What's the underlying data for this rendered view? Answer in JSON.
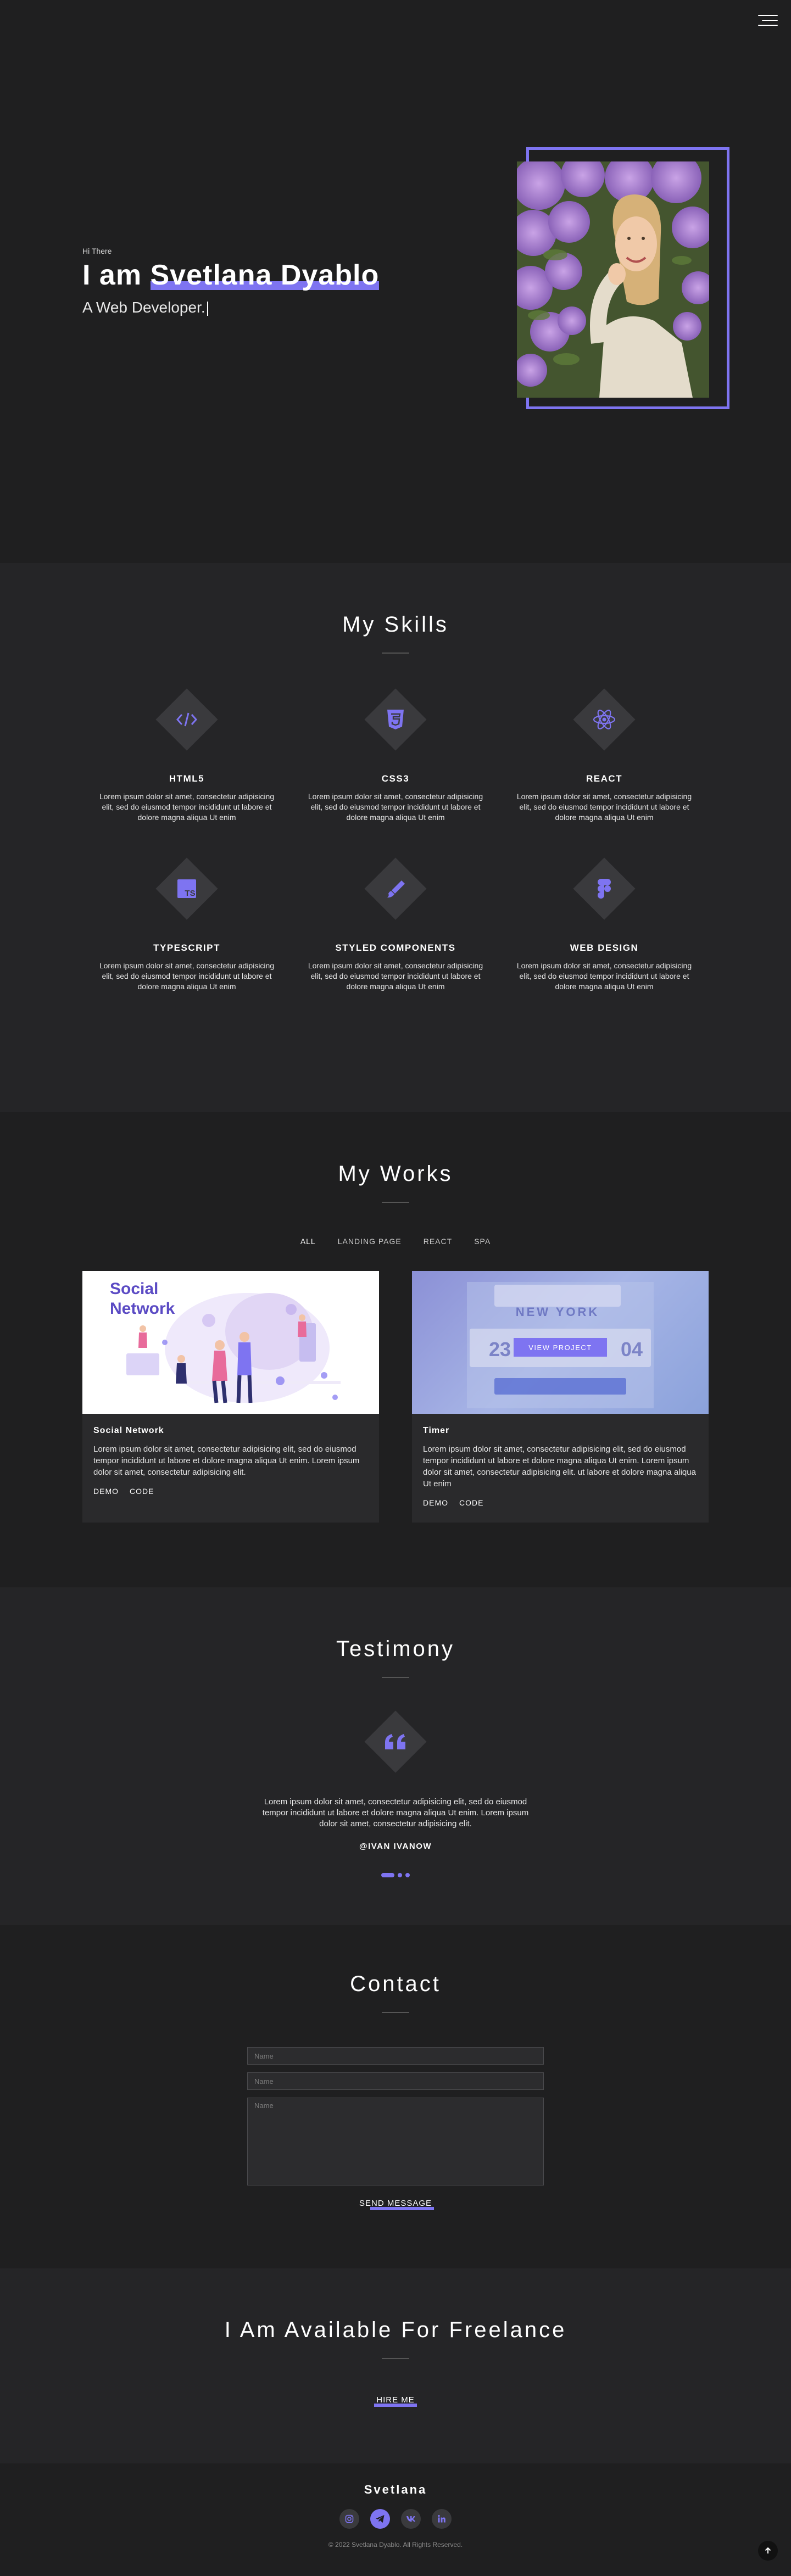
{
  "hero": {
    "greeting": "Hi There",
    "title_prefix": "I am ",
    "name": "Svetlana Dyablo",
    "subtitle": "A Web Developer."
  },
  "skills": {
    "title": "My Skills",
    "items": [
      {
        "name": "HTML5",
        "icon": "code-icon",
        "desc": "Lorem ipsum dolor sit amet, consectetur adipisicing elit, sed do eiusmod tempor incididunt ut labore et dolore magna aliqua Ut enim"
      },
      {
        "name": "CSS3",
        "icon": "css3-icon",
        "desc": "Lorem ipsum dolor sit amet, consectetur adipisicing elit, sed do eiusmod tempor incididunt ut labore et dolore magna aliqua Ut enim"
      },
      {
        "name": "REACT",
        "icon": "react-icon",
        "desc": "Lorem ipsum dolor sit amet, consectetur adipisicing elit, sed do eiusmod tempor incididunt ut labore et dolore magna aliqua Ut enim"
      },
      {
        "name": "TYPESCRIPT",
        "icon": "typescript-icon",
        "desc": "Lorem ipsum dolor sit amet, consectetur adipisicing elit, sed do eiusmod tempor incididunt ut labore et dolore magna aliqua Ut enim"
      },
      {
        "name": "STYLED COMPONENTS",
        "icon": "styled-components-icon",
        "desc": "Lorem ipsum dolor sit amet, consectetur adipisicing elit, sed do eiusmod tempor incididunt ut labore et dolore magna aliqua Ut enim"
      },
      {
        "name": "WEB DESIGN",
        "icon": "figma-icon",
        "desc": "Lorem ipsum dolor sit amet, consectetur adipisicing elit, sed do eiusmod tempor incididunt ut labore et dolore magna aliqua Ut enim"
      }
    ]
  },
  "works": {
    "title": "My Works",
    "tabs": [
      "ALL",
      "LANDING PAGE",
      "REACT",
      "SPA"
    ],
    "active_tab": "ALL",
    "items": [
      {
        "image_title_line1": "Social",
        "image_title_line2": "Network",
        "title": "Social Network",
        "desc": "Lorem ipsum dolor sit amet, consectetur adipisicing elit, sed do eiusmod tempor incididunt ut labore et dolore magna aliqua Ut enim. Lorem ipsum dolor sit amet, consectetur adipisicing elit.",
        "demo": "DEMO",
        "code": "CODE"
      },
      {
        "image_city": "NEW YORK",
        "image_days": "23",
        "image_hours": "04",
        "view_label": "VIEW PROJECT",
        "title": "Timer",
        "desc": "Lorem ipsum dolor sit amet, consectetur adipisicing elit, sed do eiusmod tempor incididunt ut labore et dolore magna aliqua Ut enim. Lorem ipsum dolor sit amet, consectetur adipisicing elit. ut labore et dolore magna aliqua Ut enim",
        "demo": "DEMO",
        "code": "CODE"
      }
    ]
  },
  "testimony": {
    "title": "Testimony",
    "text": "Lorem ipsum dolor sit amet, consectetur adipisicing elit, sed do eiusmod tempor incididunt ut labore et dolore magna aliqua Ut enim. Lorem ipsum dolor sit amet, consectetur adipisicing elit.",
    "author": "@IVAN IVANOW"
  },
  "contact": {
    "title": "Contact",
    "name_placeholder": "Name",
    "email_placeholder": "Name",
    "message_placeholder": "Name",
    "send_label": "SEND MESSAGE"
  },
  "freelance": {
    "title": "I Am Available For Freelance",
    "hire_label": "HIRE ME"
  },
  "footer": {
    "brand": "Svetlana",
    "socials": [
      "instagram-icon",
      "telegram-icon",
      "vk-icon",
      "linkedin-icon"
    ],
    "copyright": "© 2022 Svetlana Dyablo. All Rights Reserved."
  },
  "colors": {
    "accent": "#7e74f1",
    "background": "#1f1f20",
    "section_alt": "#252527"
  }
}
